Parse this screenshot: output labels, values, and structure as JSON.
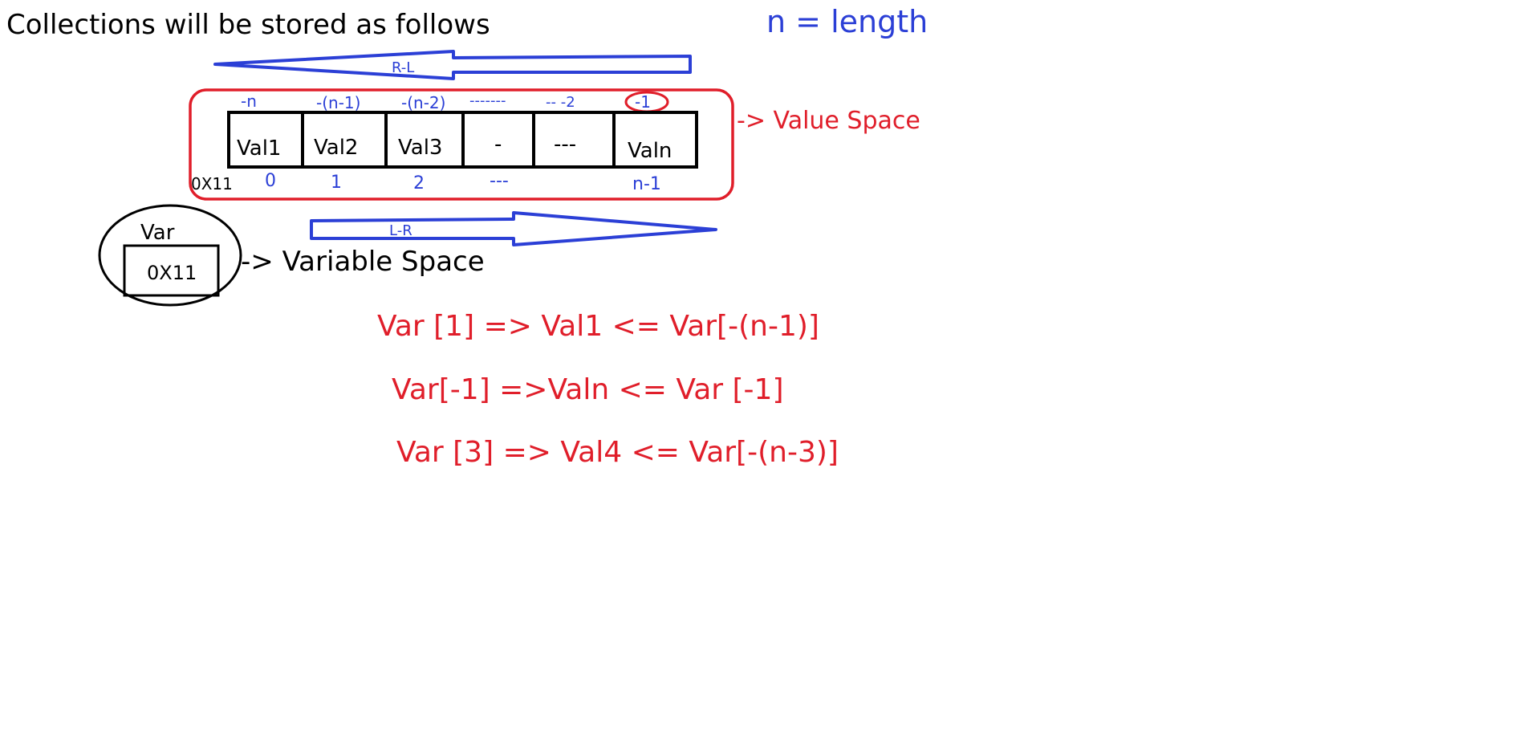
{
  "heading": "Collections will be stored as follows",
  "length_note": "n = length",
  "arrow_right_to_left": "R-L",
  "arrow_left_to_right": "L-R",
  "value_space_label": "-> Value Space",
  "variable_space_label": "-> Variable Space",
  "memory_address": "0X11",
  "variable": {
    "name": "Var",
    "address": "0X11"
  },
  "cells": [
    {
      "value": "Val1",
      "positive_index": "0",
      "negative_index": "-n"
    },
    {
      "value": "Val2",
      "positive_index": "1",
      "negative_index": "-(n-1)"
    },
    {
      "value": "Val3",
      "positive_index": "2",
      "negative_index": "-(n-2)"
    },
    {
      "value": "-",
      "positive_index": "---",
      "negative_index": "-------"
    },
    {
      "value": "---",
      "positive_index": "",
      "negative_index": "-- -2"
    },
    {
      "value": "Valn",
      "positive_index": "n-1",
      "negative_index": "-1"
    }
  ],
  "examples": [
    "Var [1] => Val1 <= Var[-(n-1)]",
    "Var[-1] =>Valn <= Var [-1]",
    "Var [3] => Val4 <= Var[-(n-3)]"
  ],
  "colors": {
    "ink": "#000000",
    "blue": "#2b3fd6",
    "red": "#e01e2a"
  }
}
